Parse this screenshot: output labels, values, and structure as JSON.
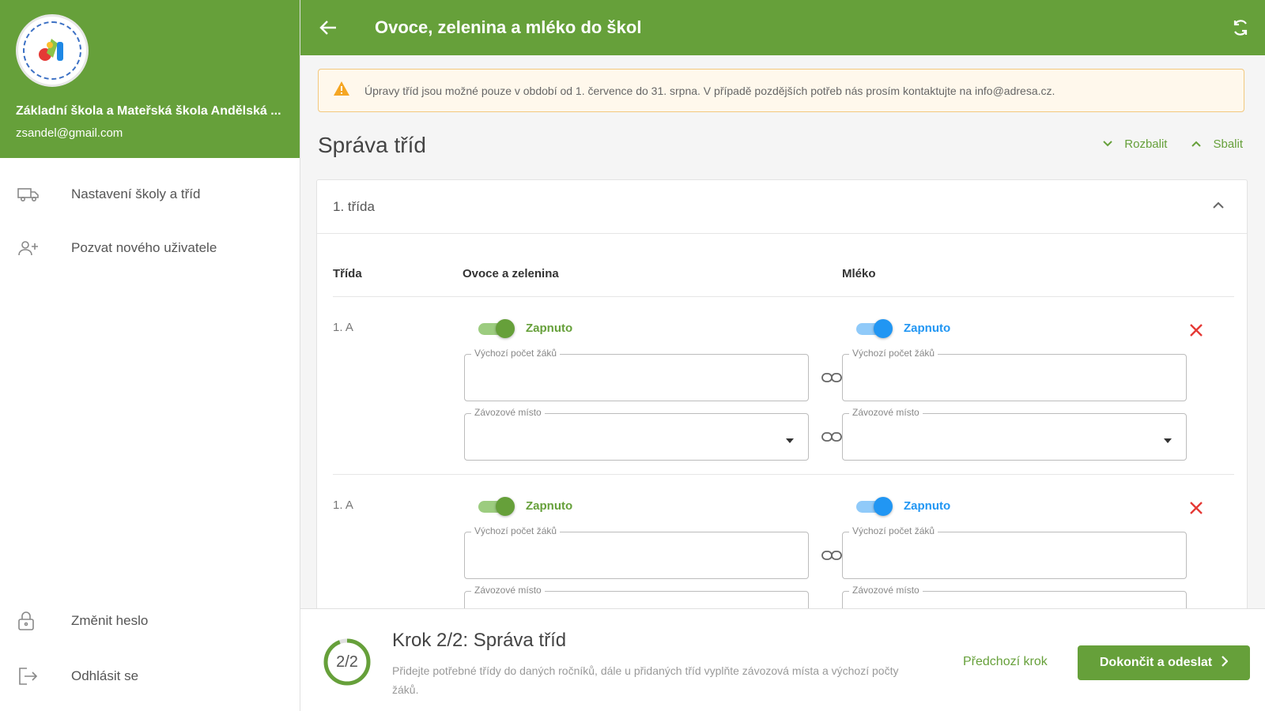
{
  "app": {
    "title": "Ovoce, zelenina a mléko do škol",
    "accent_color": "#66a03a",
    "milk_color": "#2196f3"
  },
  "sidebar": {
    "school_name": "Základní škola a Mateřská škola Andělská ...",
    "email": "zsandel@gmail.com",
    "items": [
      {
        "label": "Nastavení školy a tříd",
        "icon": "truck-icon"
      },
      {
        "label": "Pozvat nového uživatele",
        "icon": "add-user-icon"
      }
    ],
    "bottom_items": [
      {
        "label": "Změnit heslo",
        "icon": "lock-icon"
      },
      {
        "label": "Odhlásit se",
        "icon": "logout-icon"
      }
    ]
  },
  "alert": {
    "text": "Úpravy tříd jsou možné pouze v období od 1. července do 31. srpna. V případě pozdějších potřeb nás prosím kontaktujte na info@adresa.cz."
  },
  "section": {
    "title": "Správa tříd",
    "expand_label": "Rozbalit",
    "collapse_label": "Sbalit"
  },
  "panel": {
    "title": "1. třída",
    "columns": [
      "Třída",
      "Ovoce a zelenina",
      "Mléko"
    ],
    "rows": [
      {
        "class_name": "1. A",
        "fruit_toggle": "Zapnuto",
        "milk_toggle": "Zapnuto",
        "fruit_count_label": "Výchozí počet žáků",
        "milk_count_label": "Výchozí počet žáků",
        "fruit_place_label": "Závozové místo",
        "milk_place_label": "Závozové místo"
      },
      {
        "class_name": "1. A",
        "fruit_toggle": "Zapnuto",
        "milk_toggle": "Zapnuto",
        "fruit_count_label": "Výchozí počet žáků",
        "milk_count_label": "Výchozí počet žáků",
        "fruit_place_label": "Závozové místo",
        "milk_place_label": "Závozové místo"
      }
    ]
  },
  "footer": {
    "progress": "2/2",
    "step_title": "Krok 2/2: Správa tříd",
    "step_desc": "Přidejte potřebné třídy do daných ročníků, dále u přidaných tříd vyplňte závozová místa a výchozí počty žáků.",
    "prev_label": "Předchozí krok",
    "finish_label": "Dokončit a odeslat"
  }
}
